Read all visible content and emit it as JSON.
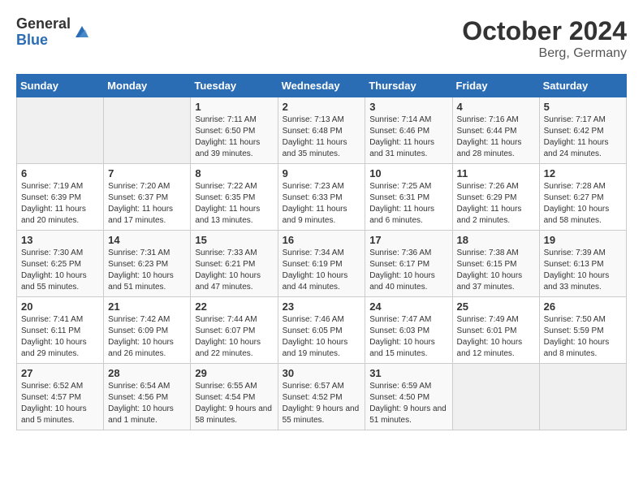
{
  "header": {
    "logo_general": "General",
    "logo_blue": "Blue",
    "month_title": "October 2024",
    "location": "Berg, Germany"
  },
  "weekdays": [
    "Sunday",
    "Monday",
    "Tuesday",
    "Wednesday",
    "Thursday",
    "Friday",
    "Saturday"
  ],
  "weeks": [
    [
      {
        "day": "",
        "info": ""
      },
      {
        "day": "",
        "info": ""
      },
      {
        "day": "1",
        "info": "Sunrise: 7:11 AM\nSunset: 6:50 PM\nDaylight: 11 hours and 39 minutes."
      },
      {
        "day": "2",
        "info": "Sunrise: 7:13 AM\nSunset: 6:48 PM\nDaylight: 11 hours and 35 minutes."
      },
      {
        "day": "3",
        "info": "Sunrise: 7:14 AM\nSunset: 6:46 PM\nDaylight: 11 hours and 31 minutes."
      },
      {
        "day": "4",
        "info": "Sunrise: 7:16 AM\nSunset: 6:44 PM\nDaylight: 11 hours and 28 minutes."
      },
      {
        "day": "5",
        "info": "Sunrise: 7:17 AM\nSunset: 6:42 PM\nDaylight: 11 hours and 24 minutes."
      }
    ],
    [
      {
        "day": "6",
        "info": "Sunrise: 7:19 AM\nSunset: 6:39 PM\nDaylight: 11 hours and 20 minutes."
      },
      {
        "day": "7",
        "info": "Sunrise: 7:20 AM\nSunset: 6:37 PM\nDaylight: 11 hours and 17 minutes."
      },
      {
        "day": "8",
        "info": "Sunrise: 7:22 AM\nSunset: 6:35 PM\nDaylight: 11 hours and 13 minutes."
      },
      {
        "day": "9",
        "info": "Sunrise: 7:23 AM\nSunset: 6:33 PM\nDaylight: 11 hours and 9 minutes."
      },
      {
        "day": "10",
        "info": "Sunrise: 7:25 AM\nSunset: 6:31 PM\nDaylight: 11 hours and 6 minutes."
      },
      {
        "day": "11",
        "info": "Sunrise: 7:26 AM\nSunset: 6:29 PM\nDaylight: 11 hours and 2 minutes."
      },
      {
        "day": "12",
        "info": "Sunrise: 7:28 AM\nSunset: 6:27 PM\nDaylight: 10 hours and 58 minutes."
      }
    ],
    [
      {
        "day": "13",
        "info": "Sunrise: 7:30 AM\nSunset: 6:25 PM\nDaylight: 10 hours and 55 minutes."
      },
      {
        "day": "14",
        "info": "Sunrise: 7:31 AM\nSunset: 6:23 PM\nDaylight: 10 hours and 51 minutes."
      },
      {
        "day": "15",
        "info": "Sunrise: 7:33 AM\nSunset: 6:21 PM\nDaylight: 10 hours and 47 minutes."
      },
      {
        "day": "16",
        "info": "Sunrise: 7:34 AM\nSunset: 6:19 PM\nDaylight: 10 hours and 44 minutes."
      },
      {
        "day": "17",
        "info": "Sunrise: 7:36 AM\nSunset: 6:17 PM\nDaylight: 10 hours and 40 minutes."
      },
      {
        "day": "18",
        "info": "Sunrise: 7:38 AM\nSunset: 6:15 PM\nDaylight: 10 hours and 37 minutes."
      },
      {
        "day": "19",
        "info": "Sunrise: 7:39 AM\nSunset: 6:13 PM\nDaylight: 10 hours and 33 minutes."
      }
    ],
    [
      {
        "day": "20",
        "info": "Sunrise: 7:41 AM\nSunset: 6:11 PM\nDaylight: 10 hours and 29 minutes."
      },
      {
        "day": "21",
        "info": "Sunrise: 7:42 AM\nSunset: 6:09 PM\nDaylight: 10 hours and 26 minutes."
      },
      {
        "day": "22",
        "info": "Sunrise: 7:44 AM\nSunset: 6:07 PM\nDaylight: 10 hours and 22 minutes."
      },
      {
        "day": "23",
        "info": "Sunrise: 7:46 AM\nSunset: 6:05 PM\nDaylight: 10 hours and 19 minutes."
      },
      {
        "day": "24",
        "info": "Sunrise: 7:47 AM\nSunset: 6:03 PM\nDaylight: 10 hours and 15 minutes."
      },
      {
        "day": "25",
        "info": "Sunrise: 7:49 AM\nSunset: 6:01 PM\nDaylight: 10 hours and 12 minutes."
      },
      {
        "day": "26",
        "info": "Sunrise: 7:50 AM\nSunset: 5:59 PM\nDaylight: 10 hours and 8 minutes."
      }
    ],
    [
      {
        "day": "27",
        "info": "Sunrise: 6:52 AM\nSunset: 4:57 PM\nDaylight: 10 hours and 5 minutes."
      },
      {
        "day": "28",
        "info": "Sunrise: 6:54 AM\nSunset: 4:56 PM\nDaylight: 10 hours and 1 minute."
      },
      {
        "day": "29",
        "info": "Sunrise: 6:55 AM\nSunset: 4:54 PM\nDaylight: 9 hours and 58 minutes."
      },
      {
        "day": "30",
        "info": "Sunrise: 6:57 AM\nSunset: 4:52 PM\nDaylight: 9 hours and 55 minutes."
      },
      {
        "day": "31",
        "info": "Sunrise: 6:59 AM\nSunset: 4:50 PM\nDaylight: 9 hours and 51 minutes."
      },
      {
        "day": "",
        "info": ""
      },
      {
        "day": "",
        "info": ""
      }
    ]
  ]
}
